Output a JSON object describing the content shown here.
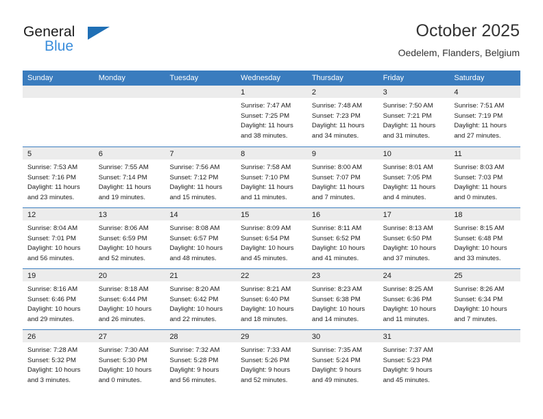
{
  "logo": {
    "word1": "General",
    "word2": "Blue",
    "triangle_color": "#1f6fb5",
    "blue_text_color": "#3a8ddb"
  },
  "header": {
    "title": "October 2025",
    "subtitle": "Oedelem, Flanders, Belgium"
  },
  "theme": {
    "header_blue": "#3a7cbe",
    "day_band_gray": "#ececec",
    "text": "#1b1b1b"
  },
  "weekday_headers": [
    "Sunday",
    "Monday",
    "Tuesday",
    "Wednesday",
    "Thursday",
    "Friday",
    "Saturday"
  ],
  "weeks": [
    [
      {
        "day": "",
        "lines": []
      },
      {
        "day": "",
        "lines": []
      },
      {
        "day": "",
        "lines": []
      },
      {
        "day": "1",
        "lines": [
          "Sunrise: 7:47 AM",
          "Sunset: 7:25 PM",
          "Daylight: 11 hours",
          "and 38 minutes."
        ]
      },
      {
        "day": "2",
        "lines": [
          "Sunrise: 7:48 AM",
          "Sunset: 7:23 PM",
          "Daylight: 11 hours",
          "and 34 minutes."
        ]
      },
      {
        "day": "3",
        "lines": [
          "Sunrise: 7:50 AM",
          "Sunset: 7:21 PM",
          "Daylight: 11 hours",
          "and 31 minutes."
        ]
      },
      {
        "day": "4",
        "lines": [
          "Sunrise: 7:51 AM",
          "Sunset: 7:19 PM",
          "Daylight: 11 hours",
          "and 27 minutes."
        ]
      }
    ],
    [
      {
        "day": "5",
        "lines": [
          "Sunrise: 7:53 AM",
          "Sunset: 7:16 PM",
          "Daylight: 11 hours",
          "and 23 minutes."
        ]
      },
      {
        "day": "6",
        "lines": [
          "Sunrise: 7:55 AM",
          "Sunset: 7:14 PM",
          "Daylight: 11 hours",
          "and 19 minutes."
        ]
      },
      {
        "day": "7",
        "lines": [
          "Sunrise: 7:56 AM",
          "Sunset: 7:12 PM",
          "Daylight: 11 hours",
          "and 15 minutes."
        ]
      },
      {
        "day": "8",
        "lines": [
          "Sunrise: 7:58 AM",
          "Sunset: 7:10 PM",
          "Daylight: 11 hours",
          "and 11 minutes."
        ]
      },
      {
        "day": "9",
        "lines": [
          "Sunrise: 8:00 AM",
          "Sunset: 7:07 PM",
          "Daylight: 11 hours",
          "and 7 minutes."
        ]
      },
      {
        "day": "10",
        "lines": [
          "Sunrise: 8:01 AM",
          "Sunset: 7:05 PM",
          "Daylight: 11 hours",
          "and 4 minutes."
        ]
      },
      {
        "day": "11",
        "lines": [
          "Sunrise: 8:03 AM",
          "Sunset: 7:03 PM",
          "Daylight: 11 hours",
          "and 0 minutes."
        ]
      }
    ],
    [
      {
        "day": "12",
        "lines": [
          "Sunrise: 8:04 AM",
          "Sunset: 7:01 PM",
          "Daylight: 10 hours",
          "and 56 minutes."
        ]
      },
      {
        "day": "13",
        "lines": [
          "Sunrise: 8:06 AM",
          "Sunset: 6:59 PM",
          "Daylight: 10 hours",
          "and 52 minutes."
        ]
      },
      {
        "day": "14",
        "lines": [
          "Sunrise: 8:08 AM",
          "Sunset: 6:57 PM",
          "Daylight: 10 hours",
          "and 48 minutes."
        ]
      },
      {
        "day": "15",
        "lines": [
          "Sunrise: 8:09 AM",
          "Sunset: 6:54 PM",
          "Daylight: 10 hours",
          "and 45 minutes."
        ]
      },
      {
        "day": "16",
        "lines": [
          "Sunrise: 8:11 AM",
          "Sunset: 6:52 PM",
          "Daylight: 10 hours",
          "and 41 minutes."
        ]
      },
      {
        "day": "17",
        "lines": [
          "Sunrise: 8:13 AM",
          "Sunset: 6:50 PM",
          "Daylight: 10 hours",
          "and 37 minutes."
        ]
      },
      {
        "day": "18",
        "lines": [
          "Sunrise: 8:15 AM",
          "Sunset: 6:48 PM",
          "Daylight: 10 hours",
          "and 33 minutes."
        ]
      }
    ],
    [
      {
        "day": "19",
        "lines": [
          "Sunrise: 8:16 AM",
          "Sunset: 6:46 PM",
          "Daylight: 10 hours",
          "and 29 minutes."
        ]
      },
      {
        "day": "20",
        "lines": [
          "Sunrise: 8:18 AM",
          "Sunset: 6:44 PM",
          "Daylight: 10 hours",
          "and 26 minutes."
        ]
      },
      {
        "day": "21",
        "lines": [
          "Sunrise: 8:20 AM",
          "Sunset: 6:42 PM",
          "Daylight: 10 hours",
          "and 22 minutes."
        ]
      },
      {
        "day": "22",
        "lines": [
          "Sunrise: 8:21 AM",
          "Sunset: 6:40 PM",
          "Daylight: 10 hours",
          "and 18 minutes."
        ]
      },
      {
        "day": "23",
        "lines": [
          "Sunrise: 8:23 AM",
          "Sunset: 6:38 PM",
          "Daylight: 10 hours",
          "and 14 minutes."
        ]
      },
      {
        "day": "24",
        "lines": [
          "Sunrise: 8:25 AM",
          "Sunset: 6:36 PM",
          "Daylight: 10 hours",
          "and 11 minutes."
        ]
      },
      {
        "day": "25",
        "lines": [
          "Sunrise: 8:26 AM",
          "Sunset: 6:34 PM",
          "Daylight: 10 hours",
          "and 7 minutes."
        ]
      }
    ],
    [
      {
        "day": "26",
        "lines": [
          "Sunrise: 7:28 AM",
          "Sunset: 5:32 PM",
          "Daylight: 10 hours",
          "and 3 minutes."
        ]
      },
      {
        "day": "27",
        "lines": [
          "Sunrise: 7:30 AM",
          "Sunset: 5:30 PM",
          "Daylight: 10 hours",
          "and 0 minutes."
        ]
      },
      {
        "day": "28",
        "lines": [
          "Sunrise: 7:32 AM",
          "Sunset: 5:28 PM",
          "Daylight: 9 hours",
          "and 56 minutes."
        ]
      },
      {
        "day": "29",
        "lines": [
          "Sunrise: 7:33 AM",
          "Sunset: 5:26 PM",
          "Daylight: 9 hours",
          "and 52 minutes."
        ]
      },
      {
        "day": "30",
        "lines": [
          "Sunrise: 7:35 AM",
          "Sunset: 5:24 PM",
          "Daylight: 9 hours",
          "and 49 minutes."
        ]
      },
      {
        "day": "31",
        "lines": [
          "Sunrise: 7:37 AM",
          "Sunset: 5:23 PM",
          "Daylight: 9 hours",
          "and 45 minutes."
        ]
      },
      {
        "day": "",
        "lines": []
      }
    ]
  ]
}
